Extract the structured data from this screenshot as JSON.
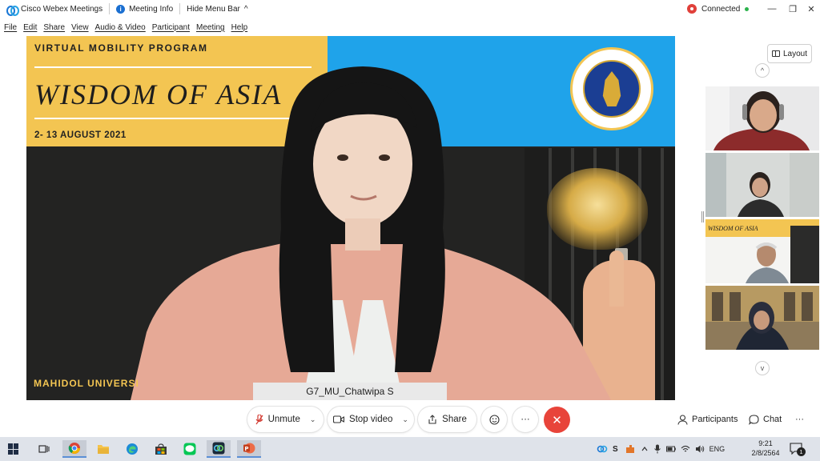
{
  "titlebar": {
    "app_name": "Cisco Webex Meetings",
    "meeting_info": "Meeting Info",
    "hide_menu": "Hide Menu Bar",
    "hide_menu_chevron": "^",
    "status": "Connected",
    "status_dot": "•"
  },
  "window_controls": {
    "minimize": "—",
    "restore": "❐",
    "close": "✕"
  },
  "menu": [
    "File",
    "Edit",
    "Share",
    "View",
    "Audio & Video",
    "Participant",
    "Meeting",
    "Help"
  ],
  "slide": {
    "program": "VIRTUAL MOBILITY PROGRAM",
    "title": "WISDOM OF ASIA",
    "dates": "2- 13 AUGUST 2021",
    "footer": "MAHIDOL UNIVERSI",
    "colors": {
      "yellow": "#f3c552",
      "blue": "#1fa3ea",
      "dark": "#232322"
    }
  },
  "active_speaker": {
    "name": "G7_MU_Chatwipa S"
  },
  "right_panel": {
    "layout_label": "Layout",
    "scroll_up": "^",
    "scroll_down": "v"
  },
  "thumbnails": [
    {
      "slide_title": ""
    },
    {
      "slide_title": ""
    },
    {
      "slide_title": "WISDOM OF ASIA"
    },
    {
      "slide_title": ""
    }
  ],
  "controls": {
    "unmute": "Unmute",
    "stop_video": "Stop video",
    "share": "Share",
    "more": "···",
    "end": "✕",
    "participants": "Participants",
    "chat": "Chat",
    "panel_more": "···",
    "chevron": "⌄"
  },
  "taskbar": {
    "language": "ENG",
    "time": "9:21",
    "date": "2/8/2564",
    "notification_count": "1",
    "tray_s": "S"
  }
}
